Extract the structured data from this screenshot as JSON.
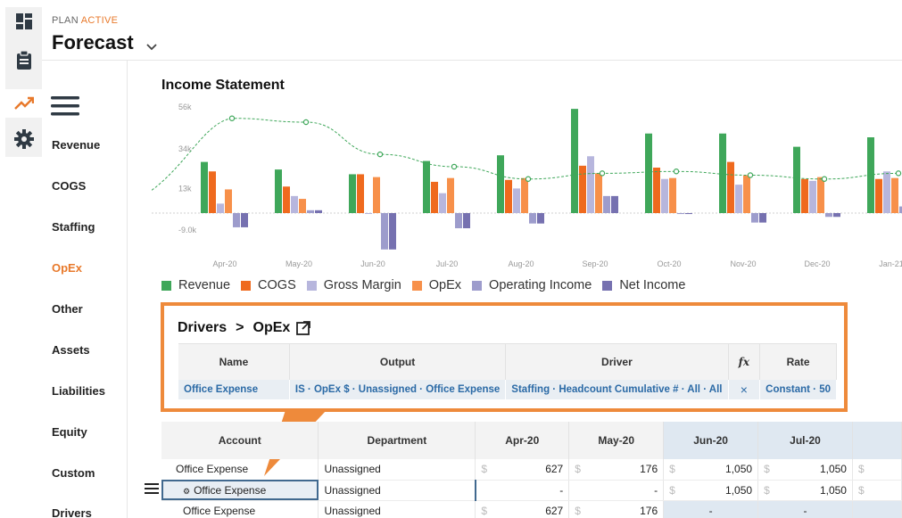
{
  "header": {
    "plan_label": "PLAN",
    "plan_status": "ACTIVE",
    "title": "Forecast"
  },
  "rail": {
    "icons": [
      "dashboard-icon",
      "clipboard-icon",
      "trend-icon",
      "gear-icon"
    ]
  },
  "nav": {
    "items": [
      {
        "label": "Revenue"
      },
      {
        "label": "COGS"
      },
      {
        "label": "Staffing"
      },
      {
        "label": "OpEx",
        "active": true
      },
      {
        "label": "Other"
      },
      {
        "label": "Assets"
      },
      {
        "label": "Liabilities"
      },
      {
        "label": "Equity"
      },
      {
        "label": "Custom"
      },
      {
        "label": "Drivers"
      }
    ]
  },
  "chart_data": {
    "type": "bar",
    "title": "Income Statement",
    "categories": [
      "Apr-20",
      "May-20",
      "Jun-20",
      "Jul-20",
      "Aug-20",
      "Sep-20",
      "Oct-20",
      "Nov-20",
      "Dec-20",
      "Jan-21"
    ],
    "y_ticks": [
      "56k",
      "34k",
      "13k",
      "-9.0k"
    ],
    "ylim": [
      -20000,
      60000
    ],
    "series": [
      {
        "name": "Revenue",
        "color": "#3fa75a",
        "values": [
          27000,
          23000,
          20500,
          27500,
          30500,
          55000,
          42000,
          42000,
          35000,
          40000
        ]
      },
      {
        "name": "COGS",
        "color": "#ef6a1e",
        "values": [
          22000,
          14000,
          20500,
          16500,
          17500,
          25000,
          24000,
          27000,
          18000,
          18000
        ]
      },
      {
        "name": "Gross Margin",
        "color": "#b7b6dd",
        "values": [
          5000,
          9000,
          -100,
          10500,
          13000,
          30000,
          18000,
          15000,
          17000,
          22000
        ]
      },
      {
        "name": "OpEx",
        "color": "#f7904a",
        "values": [
          12500,
          7500,
          19000,
          18500,
          18500,
          21000,
          18500,
          20000,
          19000,
          18500
        ]
      },
      {
        "name": "Operating Income",
        "color": "#9d9ccc",
        "values": [
          -7500,
          1500,
          -19200,
          -8000,
          -5500,
          9000,
          -500,
          -5000,
          -2000,
          3500
        ]
      },
      {
        "name": "Net Income",
        "color": "#7671b0",
        "values": [
          -7500,
          1500,
          -19200,
          -8000,
          -5500,
          9000,
          -500,
          -5000,
          -2000,
          3500
        ]
      }
    ],
    "trend_line": {
      "color": "#3fa75a",
      "values": [
        50000,
        48000,
        31000,
        24500,
        18000,
        21000,
        22000,
        20000,
        18000,
        21000
      ]
    },
    "grid": false,
    "legend_position": "bottom"
  },
  "drivers": {
    "crumb_root": "Drivers",
    "crumb_separator": ">",
    "crumb_leaf": "OpEx",
    "columns": [
      "Name",
      "Output",
      "Driver",
      "fx",
      "Rate"
    ],
    "row": {
      "name": "Office Expense",
      "output": "IS · OpEx $ · Unassigned · Office Expense",
      "driver": "Staffing · Headcount Cumulative # · All · All",
      "fx": "×",
      "rate": "Constant · 50"
    }
  },
  "grid": {
    "columns": [
      "Account",
      "Department",
      "Apr-20",
      "May-20",
      "Jun-20",
      "Jul-20"
    ],
    "currency_symbol": "$",
    "rows": [
      {
        "account": "Office Expense",
        "department": "Unassigned",
        "values": [
          "627",
          "176",
          "1,050",
          "1,050"
        ]
      },
      {
        "account": "Office Expense",
        "department": "Unassigned",
        "values": [
          "-",
          "-",
          "1,050",
          "1,050"
        ]
      },
      {
        "account": "Office Expense",
        "department": "Unassigned",
        "values": [
          "627",
          "176",
          "-",
          "-"
        ]
      }
    ]
  }
}
